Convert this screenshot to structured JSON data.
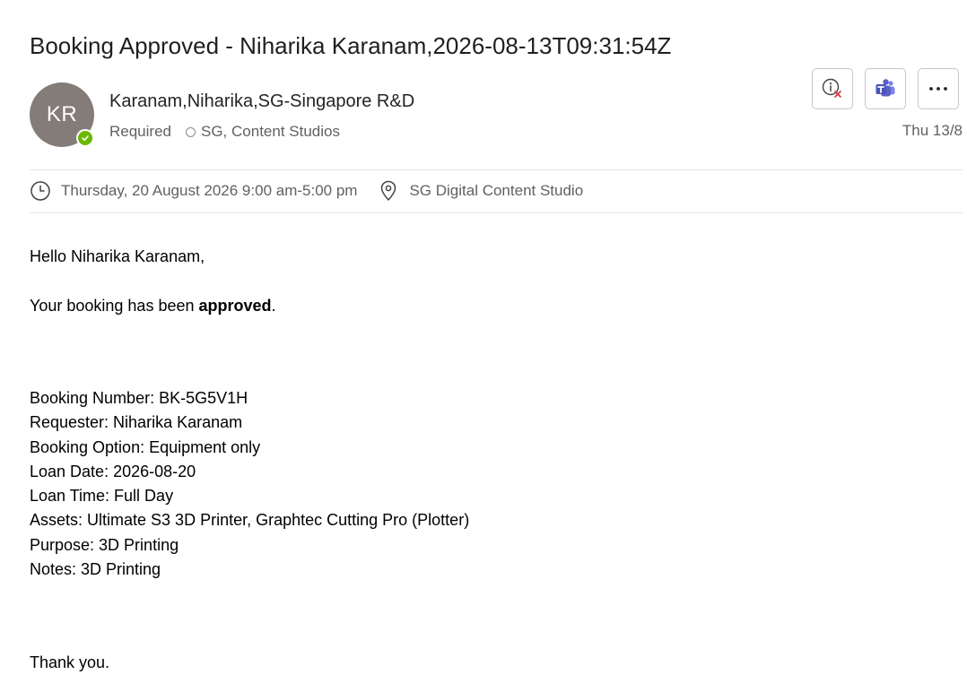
{
  "email": {
    "subject": "Booking Approved - Niharika Karanam,2026-08-13T09:31:54Z",
    "sender": {
      "initials": "KR",
      "name": "Karanam,Niharika,SG-Singapore R&D",
      "presence_color": "#6bb700",
      "avatar_color": "#847c78"
    },
    "recipients": {
      "label": "Required",
      "room": "SG, Content Studios"
    },
    "date": "Thu 13/8",
    "actions": [
      {
        "name": "info-icon",
        "label": "Info"
      },
      {
        "name": "teams-icon",
        "label": "Teams"
      },
      {
        "name": "more-icon",
        "label": "More"
      }
    ],
    "meeting": {
      "time": "Thursday, 20 August 2026 9:00 am-5:00 pm",
      "location": "SG Digital Content Studio"
    },
    "body": {
      "greeting": "Hello Niharika Karanam,",
      "approval_prefix": "Your booking has been ",
      "approval_bold": "approved",
      "approval_suffix": ".",
      "details": [
        "Booking Number: BK-5G5V1H",
        "Requester: Niharika Karanam",
        "Booking Option: Equipment only",
        "Loan Date: 2026-08-20",
        "Loan Time: Full Day",
        "Assets: Ultimate S3 3D Printer, Graphtec Cutting Pro (Plotter)",
        "Purpose: 3D Printing",
        "Notes: 3D Printing"
      ],
      "closing": "Thank you."
    }
  },
  "colors": {
    "teams_purple": "#5b5fc7",
    "decline_red": "#d13438"
  }
}
